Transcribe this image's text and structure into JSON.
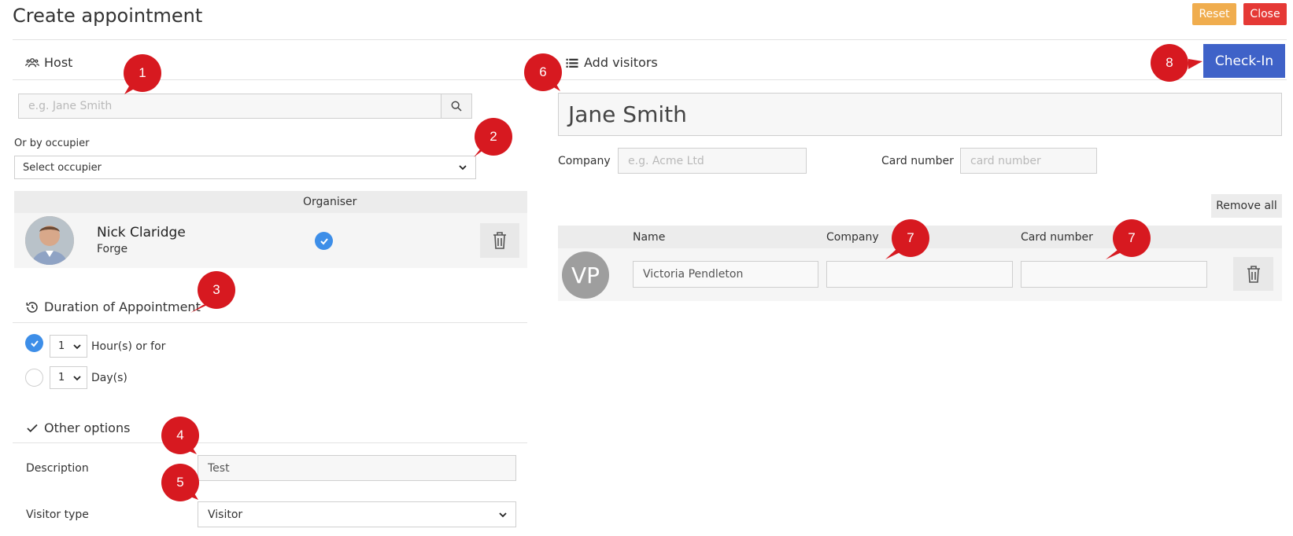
{
  "header": {
    "title": "Create appointment",
    "reset_label": "Reset",
    "close_label": "Close"
  },
  "host": {
    "section_title": "Host",
    "search_placeholder": "e.g. Jane Smith",
    "occupier_label": "Or by occupier",
    "occupier_selected": "Select occupier",
    "table_header_organiser": "Organiser",
    "person": {
      "name": "Nick Claridge",
      "company": "Forge",
      "organiser": true
    }
  },
  "duration": {
    "section_title": "Duration of Appointment",
    "hours_value": "1",
    "hours_label": "Hour(s) or for",
    "days_value": "1",
    "days_label": "Day(s)",
    "selected": "hours"
  },
  "options": {
    "section_title": "Other options",
    "description_label": "Description",
    "description_value": "Test",
    "visitor_type_label": "Visitor type",
    "visitor_type_value": "Visitor"
  },
  "visitors": {
    "section_title": "Add visitors",
    "checkin_label": "Check-In",
    "name_value": "Jane Smith",
    "company_label": "Company",
    "company_placeholder": "e.g. Acme Ltd",
    "card_label": "Card number",
    "card_placeholder": "card number",
    "remove_all_label": "Remove all",
    "columns": [
      "Name",
      "Company",
      "Card number"
    ],
    "rows": [
      {
        "initials": "VP",
        "name": "Victoria Pendleton",
        "company": "",
        "card": ""
      }
    ]
  },
  "callouts": [
    "1",
    "2",
    "3",
    "4",
    "5",
    "6",
    "7",
    "7",
    "8"
  ],
  "colors": {
    "callout": "#d71920",
    "checkin": "#3f62c8",
    "reset": "#f0ad4e",
    "close": "#e53935",
    "check": "#3d8ee8"
  }
}
